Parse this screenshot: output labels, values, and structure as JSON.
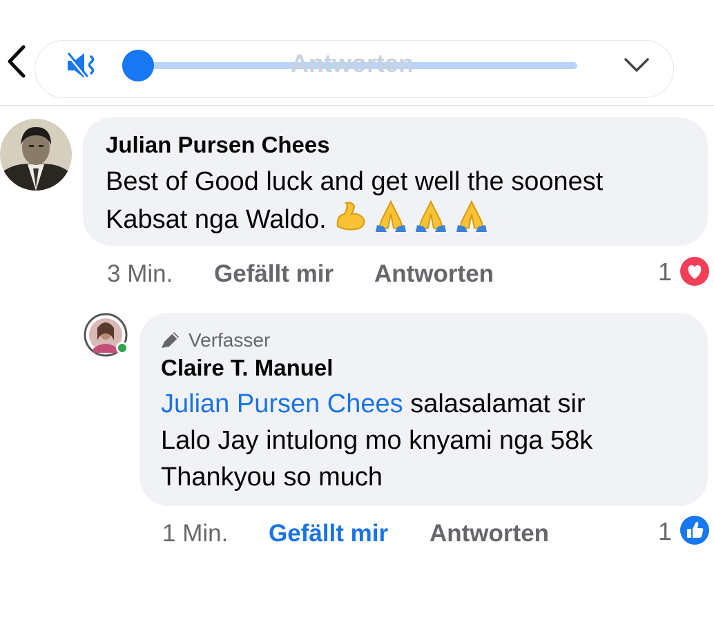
{
  "player": {
    "label": "Antworten",
    "progress": 0,
    "icons": {
      "back": "back-arrow-icon",
      "mute": "muted-speaker-icon",
      "collapse": "chevron-down-icon"
    }
  },
  "comments": [
    {
      "author": "Julian Pursen Chees",
      "text_line1": "Best of Good luck and get well the soonest",
      "text_line2": "Kabsat nga Waldo.",
      "emojis": [
        "💪",
        "🙏",
        "🙏",
        "🙏"
      ],
      "time": "3 Min.",
      "like_label": "Gefällt mir",
      "reply_label": "Antworten",
      "reaction_count": "1",
      "reaction_icon": "heart-reaction-icon"
    },
    {
      "author_badge": "Verfasser",
      "author": "Claire T. Manuel",
      "mention": "Julian Pursen Chees",
      "text_line1_rest": " salasalamat sir",
      "text_line2": "Lalo Jay intulong mo knyami nga 58k",
      "text_line3": "Thankyou so much",
      "time": "1 Min.",
      "like_label": "Gefällt mir",
      "liked": true,
      "reply_label": "Antworten",
      "reaction_count": "1",
      "reaction_icon": "like-reaction-icon",
      "online": true
    }
  ],
  "colors": {
    "accent": "#1877f2",
    "link": "#1b74e4",
    "bubble": "#f0f2f5",
    "heart": "#f33e58",
    "online": "#31a24c",
    "meta": "#65676b"
  }
}
